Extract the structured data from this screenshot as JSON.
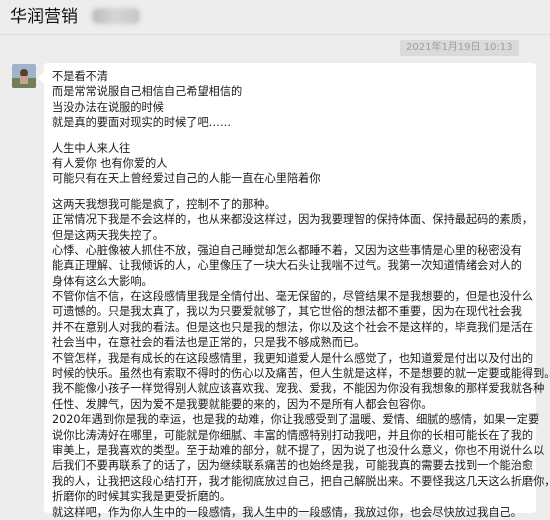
{
  "window": {
    "title": "华润营销"
  },
  "chat": {
    "timestamp": "2021年1月19日 10:13"
  },
  "message": {
    "lines": [
      "不是看不清",
      "而是常常说服自己相信自己希望相信的",
      "当没办法在说服的时候",
      "就是真的要面对现实的时候了吧……",
      "",
      "人生中人来人往",
      "有人爱你 也有你爱的人",
      "可能只有在天上曾经爱过自己的人能一直在心里陪着你",
      "",
      "这两天我想我可能是疯了，控制不了的那种。",
      "正常情况下我是不会这样的，也从来都没这样过，因为我要理智的保持体面、保持最起码的素质，",
      "但是这两天我失控了。",
      "心悸、心脏像被人抓住不放，强迫自己睡觉却怎么都睡不着，又因为这些事情是心里的秘密没有",
      "能真正理解、让我倾诉的人，心里像压了一块大石头让我喘不过气。我第一次知道情绪会对人的",
      "身体有这么大影响。",
      "不管你信不信，在这段感情里我是全情付出、毫无保留的，尽管结果不是我想要的，但是也没什么",
      "可遗憾的。只是我太真了，我以为只要爱就够了，其它世俗的想法都不重要，因为在现代社会我",
      "并不在意别人对我的看法。但是这也只是我的想法，你以及这个社会不是这样的，毕竟我们是活在",
      "社会当中，在意社会的看法也是正常的，只是我不够成熟而已。",
      "不管怎样，我是有成长的在这段感情里，我更知道爱人是什么感觉了，也知道爱是付出以及付出的",
      "时候的快乐。虽然也有索取不得时的伤心以及痛苦，但人生就是这样，不是想要的就一定要或能得到。",
      "我不能像小孩子一样觉得别人就应该喜欢我、宠我、爱我，不能因为你没有我想象的那样爱我就各种",
      "任性、发脾气，因为爱不是我要就能要的来的，因为不是所有人都会包容你。",
      "2020年遇到你是我的幸运，也是我的劫难，你让我感受到了温暖、爱情、细腻的感情，如果一定要",
      "说你比涛涛好在哪里，可能就是你细腻、丰富的情感特别打动我吧，并且你的长相可能长在了我的",
      "审美上，是我喜欢的类型。至于劫难的部分，就不提了，因为说了也没什么意义，你也不用说什么以",
      "后我们不要再联系了的话了，因为继续联系痛苦的也始终是我，可能我真的需要去找到一个能治愈",
      "我的人，让我把这段心结打开，我才能彻底放过自己，把自己解脱出来。不要怪我这几天这么折磨你，",
      "折磨你的时候其实我是更受折磨的。",
      "就这样吧，作为你人生中的一段感情，我人生中的一段感情，我放过你，也会尽快放过我自己。"
    ]
  },
  "colors": {
    "chat_background": "#ededed",
    "bubble": "#ffffff",
    "timestamp_text": "#9e9e9e"
  }
}
